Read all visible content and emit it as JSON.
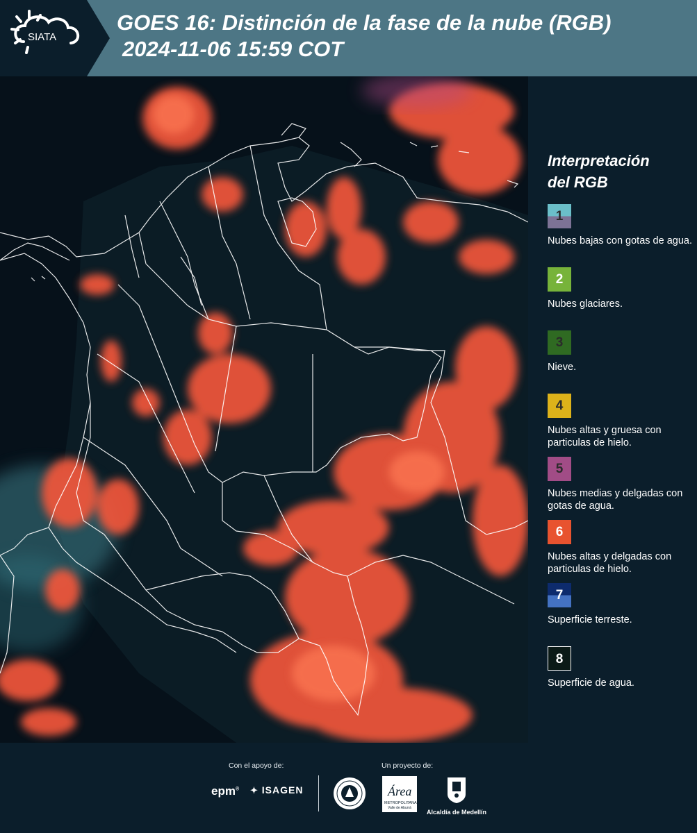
{
  "header": {
    "logo_text": "SIATA",
    "title_line1": "GOES 16: Distinción de la fase de la nube (RGB)",
    "title_line2": "2024-11-06 15:59 COT",
    "background_color": "#4d7685"
  },
  "map": {
    "description_icon": "satellite-rgb-map",
    "cloud_color": "#f2533a",
    "land_color": "#0a1a24",
    "border_color": "#ffffff"
  },
  "legend": {
    "title_line1": "Interpretación",
    "title_line2": "del RGB",
    "items": [
      {
        "number": "1",
        "label": "Nubes bajas con gotas de agua.",
        "color_top": "#6bbfc9",
        "color_bottom": "#7d7396"
      },
      {
        "number": "2",
        "label": "Nubes glaciares.",
        "color": "#77b33a"
      },
      {
        "number": "3",
        "label": "Nieve.",
        "color": "#2f6a22"
      },
      {
        "number": "4",
        "label": "Nubes altas y gruesa con particulas de hielo.",
        "color": "#ddb21a"
      },
      {
        "number": "5",
        "label": "Nubes medias y delgadas con gotas de agua.",
        "color": "#a14c86"
      },
      {
        "number": "6",
        "label": "Nubes altas y delgadas con particulas de hielo.",
        "color": "#e8532f"
      },
      {
        "number": "7",
        "label": "Superficie terreste.",
        "color_top": "#0d2b6d",
        "color_bottom": "#4472c2"
      },
      {
        "number": "8",
        "label": "Superficie de agua.",
        "color": "#0b1a17"
      }
    ]
  },
  "footer": {
    "support_label": "Con el apoyo de:",
    "project_label": "Un proyecto de:",
    "sponsor_epm": "epm",
    "sponsor_isagen": "ISAGEN",
    "area_logo_text": "Área",
    "area_logo_sub1": "METROPOLITANA",
    "area_logo_sub2": "Valle de Aburrá",
    "alcaldia_text": "Alcaldía de Medellín"
  }
}
